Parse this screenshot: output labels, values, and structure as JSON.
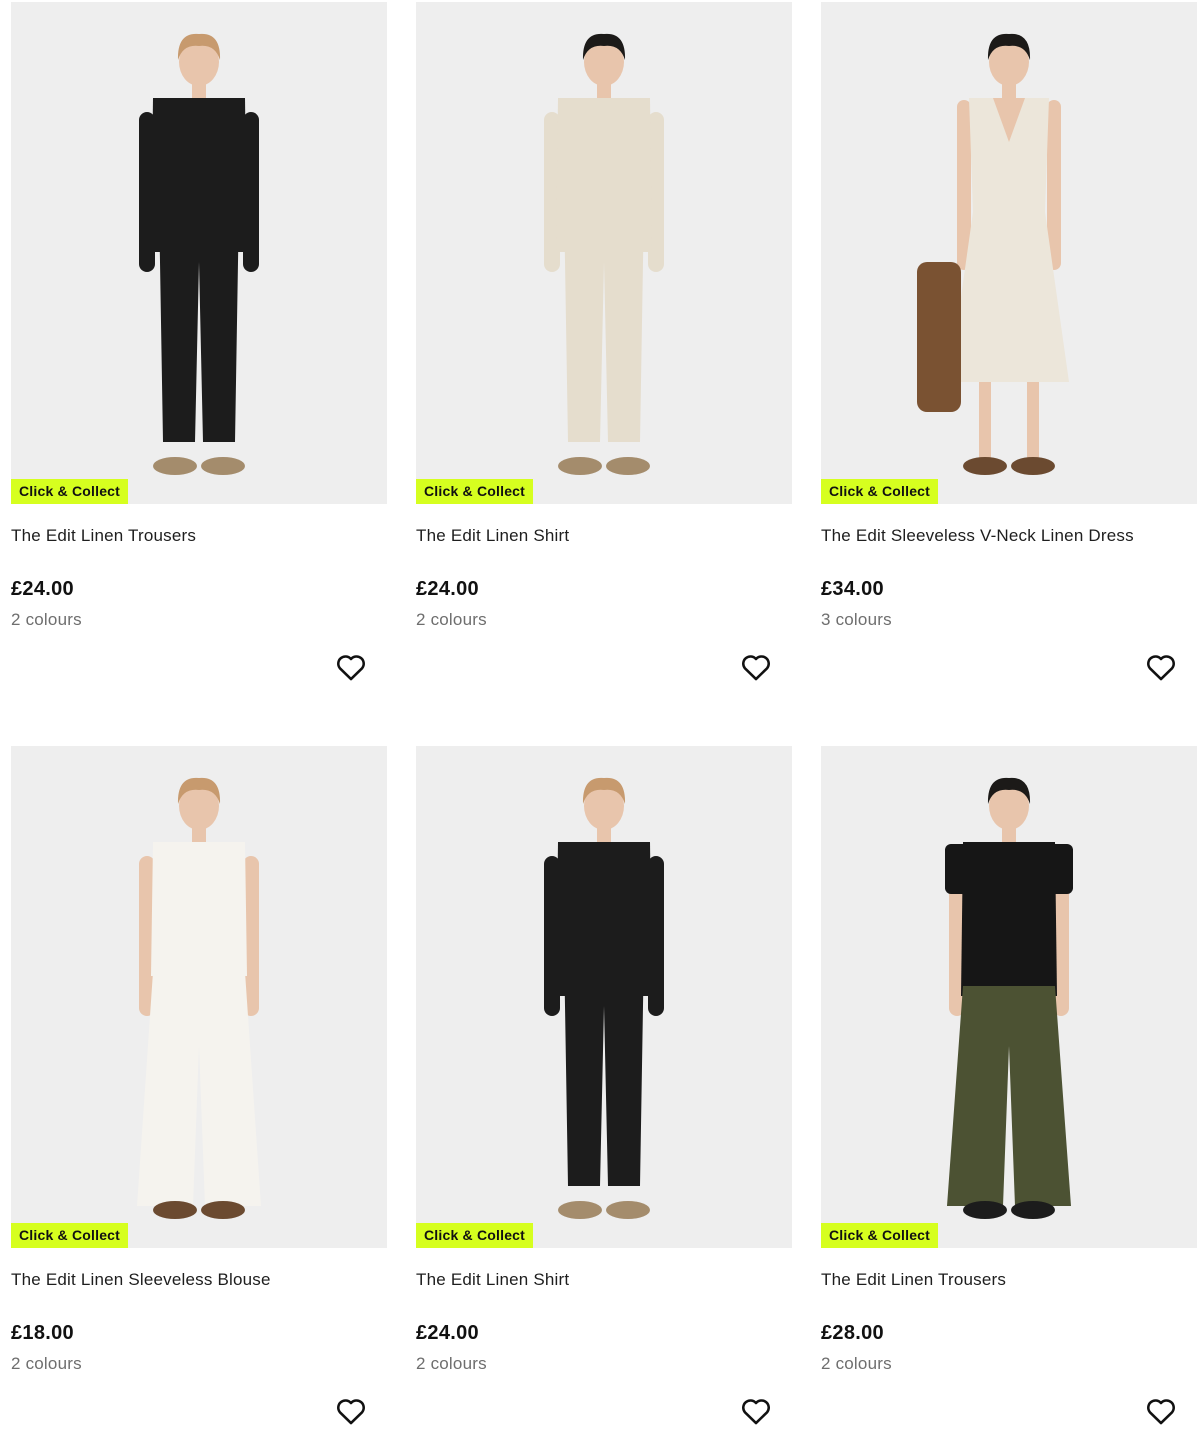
{
  "products": [
    {
      "name": "The Edit Linen Trousers",
      "price": "£24.00",
      "colours": "2 colours",
      "badge": "Click & Collect",
      "icon": "heart-outline-icon",
      "model": {
        "hair": "#c79a6e",
        "top": "#1c1c1c",
        "bottom": "#1c1c1c",
        "shoes": "#a48c6c",
        "style": "shirt-trousers"
      }
    },
    {
      "name": "The Edit Linen Shirt",
      "price": "£24.00",
      "colours": "2 colours",
      "badge": "Click & Collect",
      "icon": "heart-outline-icon",
      "model": {
        "hair": "#1c1a18",
        "top": "#e5ddcd",
        "bottom": "#e5ddcd",
        "shoes": "#a48c6c",
        "style": "shirt-trousers"
      }
    },
    {
      "name": "The Edit Sleeveless V-Neck Linen Dress",
      "price": "£34.00",
      "colours": "3 colours",
      "badge": "Click & Collect",
      "icon": "heart-outline-icon",
      "model": {
        "hair": "#1c1a18",
        "top": "#ece6da",
        "bottom": "#ece6da",
        "shoes": "#6b4a30",
        "style": "dress"
      }
    },
    {
      "name": "The Edit Linen Sleeveless Blouse",
      "price": "£18.00",
      "colours": "2 colours",
      "badge": "Click & Collect",
      "icon": "heart-outline-icon",
      "model": {
        "hair": "#c79a6e",
        "top": "#f5f3ee",
        "bottom": "#f5f3ee",
        "shoes": "#6b4a30",
        "style": "sleeveless-wide"
      }
    },
    {
      "name": "The Edit Linen Shirt",
      "price": "£24.00",
      "colours": "2 colours",
      "badge": "Click & Collect",
      "icon": "heart-outline-icon",
      "model": {
        "hair": "#c79a6e",
        "top": "#1c1c1c",
        "bottom": "#1c1c1c",
        "shoes": "#a48c6c",
        "style": "shirt-trousers"
      }
    },
    {
      "name": "The Edit Linen Trousers",
      "price": "£28.00",
      "colours": "2 colours",
      "badge": "Click & Collect",
      "icon": "heart-outline-icon",
      "model": {
        "hair": "#1c1a18",
        "top": "#161616",
        "bottom": "#4c5233",
        "shoes": "#1c1c1c",
        "style": "tee-wide"
      }
    }
  ],
  "colors": {
    "badge": "#d6ff1f",
    "image_bg": "#eeeeee",
    "price": "#111111",
    "muted": "#6e6e6e"
  }
}
